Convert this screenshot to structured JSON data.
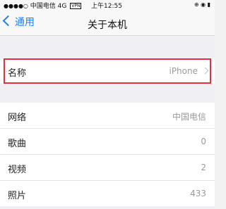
{
  "status_bar": {
    "signal": "●●●●○",
    "carrier": "中国电信",
    "network": "4G",
    "vpn": "VPN",
    "time": "上午12:55",
    "right_icons": "⊕ ◉ ▮"
  },
  "nav": {
    "back_label": "通用",
    "title": "关于本机"
  },
  "name_row": {
    "label": "名称",
    "value": "iPhone"
  },
  "info_rows": [
    {
      "label": "网络",
      "value": "中国电信"
    },
    {
      "label": "歌曲",
      "value": "0"
    },
    {
      "label": "视频",
      "value": "2"
    },
    {
      "label": "照片",
      "value": "433"
    }
  ],
  "colors": {
    "accent": "#1f7ef3",
    "highlight": "#e0323e",
    "background": "#efeff4"
  }
}
